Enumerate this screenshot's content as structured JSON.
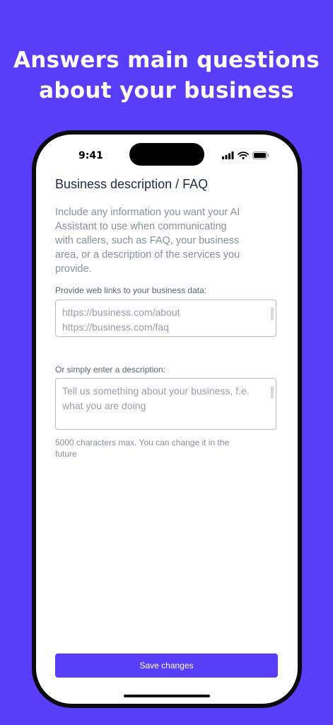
{
  "promo": {
    "headline_line1": "Answers main questions",
    "headline_line2": "about your business"
  },
  "status_bar": {
    "time": "9:41",
    "icons": [
      "signal-icon",
      "wifi-icon",
      "battery-icon"
    ]
  },
  "screen": {
    "title": "Business description / FAQ",
    "intro": "Include any information you want your AI Assistant to use when communicating with callers, such as FAQ, your business area, or a description of the services you provide.",
    "links_label": "Provide web links to your business data:",
    "links_placeholder": "https://business.com/about\nhttps://business.com/faq",
    "description_label": "Or simply enter a description:",
    "description_placeholder": "Tell us something about your business, f.e. what you are doing",
    "helper_text": "5000 characters max. You can change it in the future",
    "save_label": "Save changes"
  },
  "colors": {
    "accent": "#5A3DFB",
    "title_text": "#1F2A44",
    "muted_text": "#8A8F9C"
  }
}
